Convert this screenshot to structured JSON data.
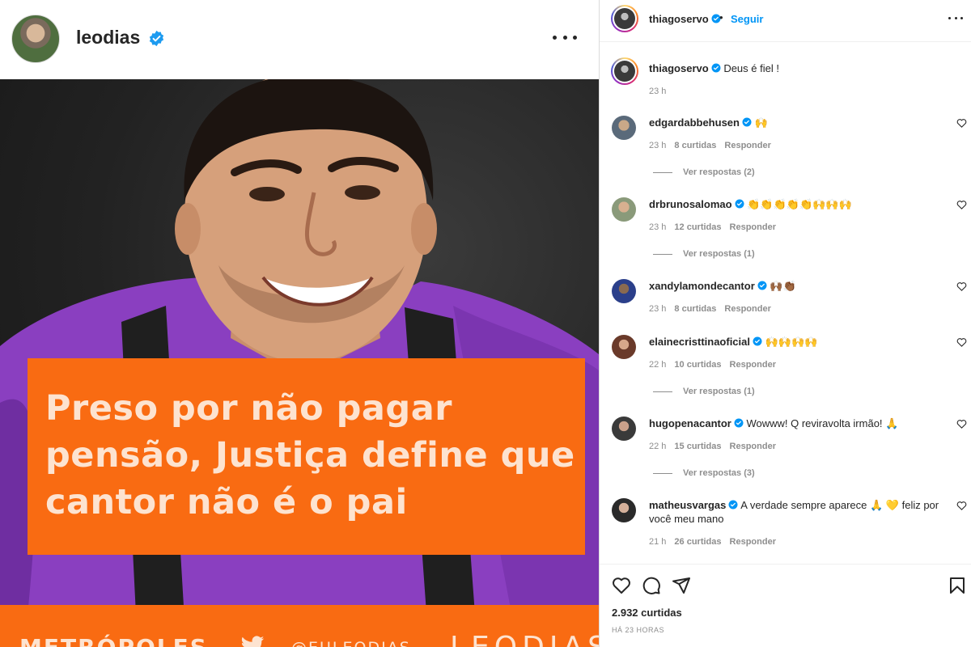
{
  "post": {
    "username": "leodias",
    "headline": "Preso por não pagar pensão, Justiça define que cantor não é o pai",
    "footer": {
      "brand_left": "METRÓPOLES",
      "handle": "@EULEODIAS",
      "brand_right": "LEODIAS"
    },
    "colors": {
      "accent_orange": "#f96b12",
      "verified_blue": "#0095f6",
      "shirt_purple": "#8a3fc0"
    }
  },
  "panel": {
    "header": {
      "username": "thiagoservo",
      "separator": "•",
      "follow_label": "Seguir"
    },
    "caption": {
      "username": "thiagoservo",
      "text": "Deus é fiel !",
      "time": "23 h"
    },
    "comments": [
      {
        "username": "edgardabbehusen",
        "text": "🙌",
        "time": "23 h",
        "likes": "8 curtidas",
        "reply": "Responder",
        "view_replies": "Ver respostas (2)"
      },
      {
        "username": "drbrunosalomao",
        "text": "👏👏👏👏👏🙌🙌🙌",
        "time": "23 h",
        "likes": "12 curtidas",
        "reply": "Responder",
        "view_replies": "Ver respostas (1)"
      },
      {
        "username": "xandylamondecantor",
        "text": "🙌🏾👏🏾",
        "time": "23 h",
        "likes": "8 curtidas",
        "reply": "Responder",
        "view_replies": ""
      },
      {
        "username": "elainecristtinaoficial",
        "text": "🙌🙌🙌🙌",
        "time": "22 h",
        "likes": "10 curtidas",
        "reply": "Responder",
        "view_replies": "Ver respostas (1)"
      },
      {
        "username": "hugopenacantor",
        "text": "Wowww! Q reviravolta irmão! 🙏",
        "time": "22 h",
        "likes": "15 curtidas",
        "reply": "Responder",
        "view_replies": "Ver respostas (3)"
      },
      {
        "username": "matheusvargas",
        "text": "A verdade sempre aparece 🙏 💛 feliz por você meu mano",
        "time": "21 h",
        "likes": "26 curtidas",
        "reply": "Responder",
        "view_replies": ""
      }
    ],
    "actions": {
      "icons": [
        "heart-icon",
        "comment-icon",
        "share-icon",
        "bookmark-icon"
      ],
      "likes": "2.932 curtidas",
      "posted": "HÁ 23 HORAS"
    }
  }
}
